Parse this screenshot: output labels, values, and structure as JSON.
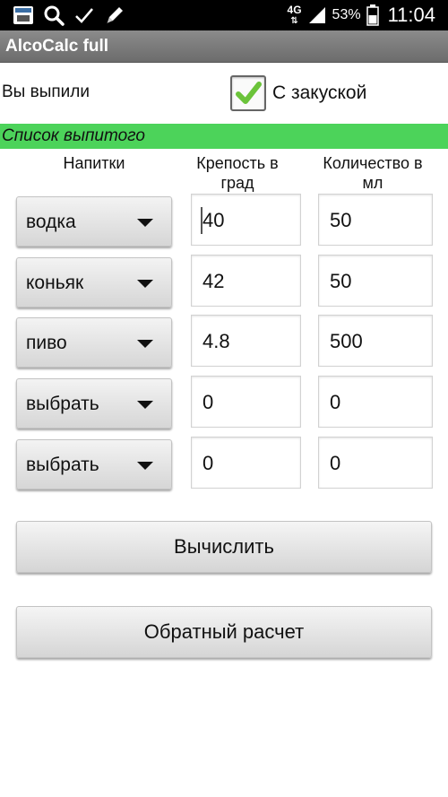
{
  "status_bar": {
    "network": "4G",
    "battery": "53%",
    "time": "11:04"
  },
  "app": {
    "title": "AlcoCalc full"
  },
  "drank": {
    "label": "Вы выпили"
  },
  "snack": {
    "label": "С закуской",
    "checked": true
  },
  "section": {
    "title": "Список выпитого"
  },
  "columns": {
    "drinks": "Напитки",
    "strength_line1": "Крепость в",
    "strength_line2": "град",
    "volume_line1": "Количество в",
    "volume_line2": "мл"
  },
  "rows": [
    {
      "drink": "водка",
      "strength": "40",
      "volume": "50"
    },
    {
      "drink": "коньяк",
      "strength": "42",
      "volume": "50"
    },
    {
      "drink": "пиво",
      "strength": "4.8",
      "volume": "500"
    },
    {
      "drink": "выбрать",
      "strength": "0",
      "volume": "0"
    },
    {
      "drink": "выбрать",
      "strength": "0",
      "volume": "0"
    }
  ],
  "buttons": {
    "calculate": "Вычислить",
    "reverse": "Обратный расчет"
  },
  "colors": {
    "section_bg": "#4cd35a",
    "check_green": "#6bc33a",
    "action_bar": "#7a7a7a"
  }
}
